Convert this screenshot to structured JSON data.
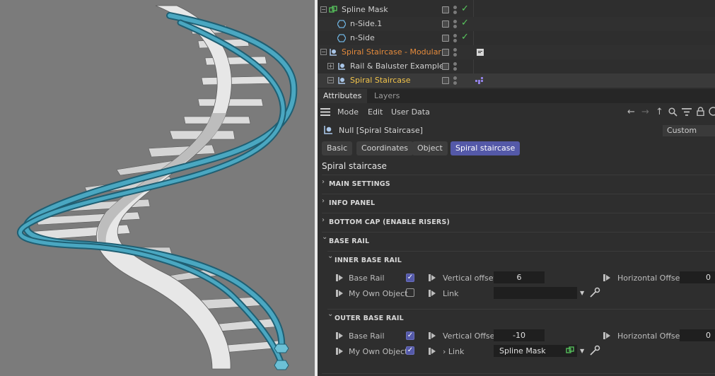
{
  "object_manager": {
    "rows": [
      {
        "name": "Spline Mask",
        "color": "#cfcfcf",
        "check": true
      },
      {
        "name": "n-Side.1",
        "color": "#cfcfcf",
        "check": true
      },
      {
        "name": "n-Side",
        "color": "#cfcfcf",
        "check": true
      },
      {
        "name": "Spiral Staircase - Modular",
        "color": "#e38a3c",
        "check": false
      },
      {
        "name": "Rail & Baluster Example",
        "color": "#cfcfcf",
        "check": false
      },
      {
        "name": "Spiral Staircase",
        "color": "#f2c44a",
        "check": false
      }
    ],
    "check_glyph": "✓",
    "expand_glyph_open": "−",
    "expand_glyph_closed": "+"
  },
  "attr_tabs": {
    "attributes": "Attributes",
    "layers": "Layers"
  },
  "menu": {
    "mode": "Mode",
    "edit": "Edit",
    "user_data": "User Data"
  },
  "toolbar_icons": {
    "back": "←",
    "forward": "→",
    "up": "↑",
    "search": "⚲",
    "filter": "≡",
    "lock": "🔒"
  },
  "object_line": {
    "title": "Null [Spiral Staircase]",
    "preset": "Custom"
  },
  "prop_tabs": {
    "basic": "Basic",
    "coordinates": "Coordinates",
    "object": "Object",
    "spiral": "Spiral staircase"
  },
  "section_title": "Spiral staircase",
  "groups": {
    "main": "MAIN SETTINGS",
    "info": "INFO PANEL",
    "bottom": "BOTTOM CAP (ENABLE RISERS)",
    "base_rail": "BASE RAIL",
    "inner": "INNER BASE RAIL",
    "outer": "OUTER BASE RAIL"
  },
  "group_arrows": {
    "closed": "›",
    "open": "⌄"
  },
  "inner": {
    "base_rail_label": "Base Rail",
    "base_rail_checked": true,
    "vertical_offset_label": "Vertical offset",
    "vertical_offset": "6",
    "horizontal_offset_label": "Horizontal Offset",
    "horizontal_offset": "0",
    "my_own_object_label": "My Own Object",
    "my_own_object_checked": false,
    "link_label": "Link",
    "link_value": ""
  },
  "outer": {
    "base_rail_label": "Base Rail",
    "base_rail_checked": true,
    "vertical_offset_label": "Vertical Offset",
    "vertical_offset": "-10",
    "horizontal_offset_label": "Horizontal Offset",
    "horizontal_offset": "0",
    "my_own_object_label": "My Own Object",
    "my_own_object_checked": true,
    "link_label": "› Link",
    "link_value": "Spline Mask"
  },
  "colors": {
    "accent": "#5459a8",
    "rail": "#3c95ad",
    "viewport_bg": "#7b7b7b",
    "spline_green": "#58c85e"
  }
}
